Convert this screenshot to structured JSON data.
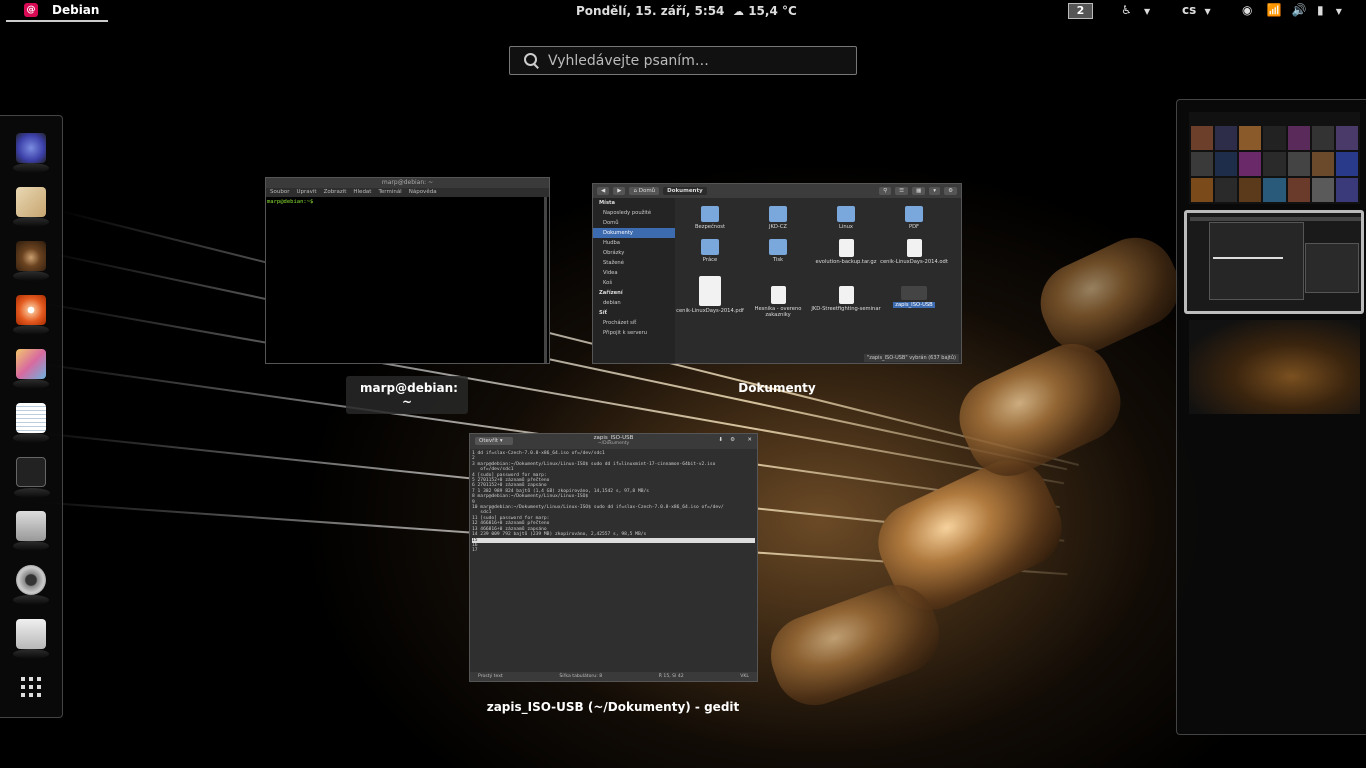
{
  "topbar": {
    "activities_label": "Debian",
    "clock": "Pondělí, 15. září,  5:54",
    "weather": "15,4 °C",
    "workspace_number": "2",
    "language": "cs"
  },
  "search": {
    "placeholder": "Vyhledávejte psaním…"
  },
  "dock": {
    "items": [
      "browser-icon",
      "mail-icon",
      "audio-player-icon",
      "disc-icon",
      "paint-icon",
      "text-editor-icon",
      "terminal-icon",
      "mixer-icon",
      "camera-icon",
      "files-icon"
    ]
  },
  "windows": {
    "terminal": {
      "caption": "marp@debian: ~",
      "titlebar": "marp@debian: ~",
      "menu": [
        "Soubor",
        "Upravit",
        "Zobrazit",
        "Hledat",
        "Terminál",
        "Nápověda"
      ],
      "prompt": "marp@debian:~$"
    },
    "nautilus": {
      "caption": "Dokumenty",
      "path": [
        "Domů",
        "Dokumenty"
      ],
      "sidebar": {
        "places_heading": "Místa",
        "places": [
          "Naposledy použité",
          "Domů",
          "Dokumenty",
          "Hudba",
          "Obrázky",
          "Stažené",
          "Videa",
          "Koš"
        ],
        "devices_heading": "Zařízení",
        "devices": [
          "debian"
        ],
        "network_heading": "Síť",
        "network": [
          "Procházet síť",
          "Připojit k serveru"
        ]
      },
      "files": [
        "Bezpečnost",
        "JKD-CZ",
        "Linux",
        "PDF",
        "Práce",
        "Tisk",
        "evolution-backup.tar.gz",
        "cenik-LinuxDays-2014.odt",
        "cenik-LinuxDays-2014.pdf",
        "Hesnika - overeno zakazniky",
        "JKD-Streetfighting-seminar",
        "zapis_ISO-USB"
      ],
      "status": "\"zapis_ISO-USB\" vybrán (637 bajtů)"
    },
    "gedit": {
      "caption": "zapis_ISO-USB (~/Dokumenty) - gedit",
      "open_label": "Otevřít",
      "title": "zapis_ISO-USB",
      "subtitle": "~/Dokumenty",
      "lines": [
        "1 dd if=slax-Czech-7.0.8-x86_64.iso of=/dev/sdc1",
        "2",
        "3 marp@debian:~/Dokumenty/Linux/Linux-ISO$ sudo dd if=linuxmint-17-cinnamon-64bit-v2.iso",
        "   of=/dev/sdc1",
        "4 [sudo] password for marp:",
        "5 2701152+0 záznamů přečteno",
        "6 2701152+0 záznamů zapsáno",
        "7 1 382 989 824 bajtů (1,4 GB) zkopírováno, 14,1542 s, 97,8 MB/s",
        "8 marp@debian:~/Dokumenty/Linux/Linux-ISO$",
        "9",
        "10 marp@debian:~/Dokumenty/Linux/Linux-ISO$ sudo dd if=slax-Czech-7.0.8-x86_64.iso of=/dev/",
        "   sdc1",
        "11 [sudo] password for marp:",
        "12 466816+0 záznamů přečteno",
        "13 466816+0 záznamů zapsáno",
        "14 239 009 792 bajtů (239 MB) zkopírováno, 2,42557 s, 98,5 MB/s",
        "15",
        "16",
        "17"
      ],
      "status_left": "Prostý text",
      "status_tab": "Šířka tabulátoru: 8",
      "status_pos": "Ř 15, Sl 42",
      "status_ins": "VKL"
    }
  },
  "colors": {
    "accent": "#3d6bb0",
    "debian": "#d70a53"
  }
}
